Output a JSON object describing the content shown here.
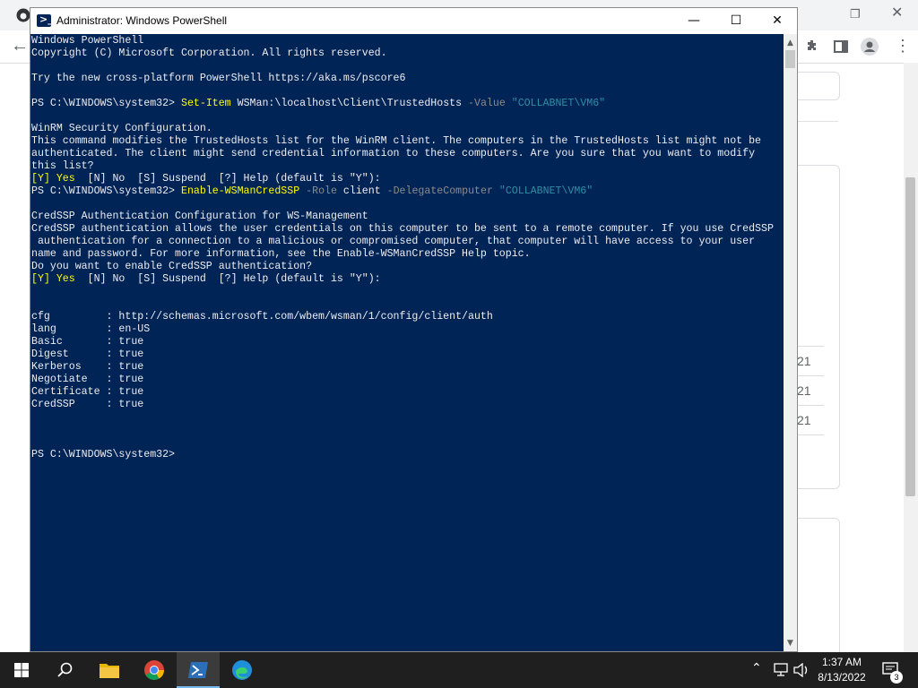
{
  "powershell": {
    "title": "Administrator: Windows PowerShell",
    "lines": [
      [
        {
          "t": "Windows PowerShell",
          "c": "normal"
        }
      ],
      [
        {
          "t": "Copyright (C) Microsoft Corporation. All rights reserved.",
          "c": "normal"
        }
      ],
      [
        {
          "t": "",
          "c": "normal"
        }
      ],
      [
        {
          "t": "Try the new cross-platform PowerShell https://aka.ms/pscore6",
          "c": "normal"
        }
      ],
      [
        {
          "t": "",
          "c": "normal"
        }
      ],
      [
        {
          "t": "PS C:\\WINDOWS\\system32> ",
          "c": "normal"
        },
        {
          "t": "Set-Item",
          "c": "y"
        },
        {
          "t": " WSMan:\\localhost\\Client\\TrustedHosts ",
          "c": "normal"
        },
        {
          "t": "-Value",
          "c": "param"
        },
        {
          "t": " \"COLLABNET\\VM6\"",
          "c": "str"
        }
      ],
      [
        {
          "t": "",
          "c": "normal"
        }
      ],
      [
        {
          "t": "WinRM Security Configuration.",
          "c": "normal"
        }
      ],
      [
        {
          "t": "This command modifies the TrustedHosts list for the WinRM client. The computers in the TrustedHosts list might not be",
          "c": "normal"
        }
      ],
      [
        {
          "t": "authenticated. The client might send credential information to these computers. Are you sure that you want to modify",
          "c": "normal"
        }
      ],
      [
        {
          "t": "this list?",
          "c": "normal"
        }
      ],
      [
        {
          "t": "[Y] Yes",
          "c": "y"
        },
        {
          "t": "  [N] No  [S] Suspend  [?] Help (default is \"Y\"):",
          "c": "normal"
        }
      ],
      [
        {
          "t": "PS C:\\WINDOWS\\system32> ",
          "c": "normal"
        },
        {
          "t": "Enable-WSManCredSSP",
          "c": "y"
        },
        {
          "t": " ",
          "c": "normal"
        },
        {
          "t": "-Role",
          "c": "param"
        },
        {
          "t": " client ",
          "c": "normal"
        },
        {
          "t": "-DelegateComputer",
          "c": "param"
        },
        {
          "t": " \"COLLABNET\\VM6\"",
          "c": "str"
        }
      ],
      [
        {
          "t": "",
          "c": "normal"
        }
      ],
      [
        {
          "t": "CredSSP Authentication Configuration for WS-Management",
          "c": "normal"
        }
      ],
      [
        {
          "t": "CredSSP authentication allows the user credentials on this computer to be sent to a remote computer. If you use CredSSP",
          "c": "normal"
        }
      ],
      [
        {
          "t": " authentication for a connection to a malicious or compromised computer, that computer will have access to your user",
          "c": "normal"
        }
      ],
      [
        {
          "t": "name and password. For more information, see the Enable-WSManCredSSP Help topic.",
          "c": "normal"
        }
      ],
      [
        {
          "t": "Do you want to enable CredSSP authentication?",
          "c": "normal"
        }
      ],
      [
        {
          "t": "[Y] Yes",
          "c": "y"
        },
        {
          "t": "  [N] No  [S] Suspend  [?] Help (default is \"Y\"):",
          "c": "normal"
        }
      ],
      [
        {
          "t": "",
          "c": "normal"
        }
      ],
      [
        {
          "t": "",
          "c": "normal"
        }
      ],
      [
        {
          "t": "cfg         : http://schemas.microsoft.com/wbem/wsman/1/config/client/auth",
          "c": "normal"
        }
      ],
      [
        {
          "t": "lang        : en-US",
          "c": "normal"
        }
      ],
      [
        {
          "t": "Basic       : true",
          "c": "normal"
        }
      ],
      [
        {
          "t": "Digest      : true",
          "c": "normal"
        }
      ],
      [
        {
          "t": "Kerberos    : true",
          "c": "normal"
        }
      ],
      [
        {
          "t": "Negotiate   : true",
          "c": "normal"
        }
      ],
      [
        {
          "t": "Certificate : true",
          "c": "normal"
        }
      ],
      [
        {
          "t": "CredSSP     : true",
          "c": "normal"
        }
      ],
      [
        {
          "t": "",
          "c": "normal"
        }
      ],
      [
        {
          "t": "",
          "c": "normal"
        }
      ],
      [
        {
          "t": "",
          "c": "normal"
        }
      ],
      [
        {
          "t": "PS C:\\WINDOWS\\system32>",
          "c": "normal"
        }
      ]
    ],
    "colors": {
      "background": "#012456",
      "text": "#eeedf0",
      "command": "#ffff00",
      "parameter": "#8c8c8c",
      "string": "#2f8ea6"
    }
  },
  "browser_background": {
    "partial_values": [
      "21",
      "21",
      "21"
    ]
  },
  "taskbar": {
    "items": [
      "start-icon",
      "search-icon",
      "file-explorer-icon",
      "chrome-icon",
      "powershell-icon",
      "edge-icon"
    ],
    "clock_time": "1:37 AM",
    "clock_date": "8/13/2022",
    "notification_count": "3"
  }
}
